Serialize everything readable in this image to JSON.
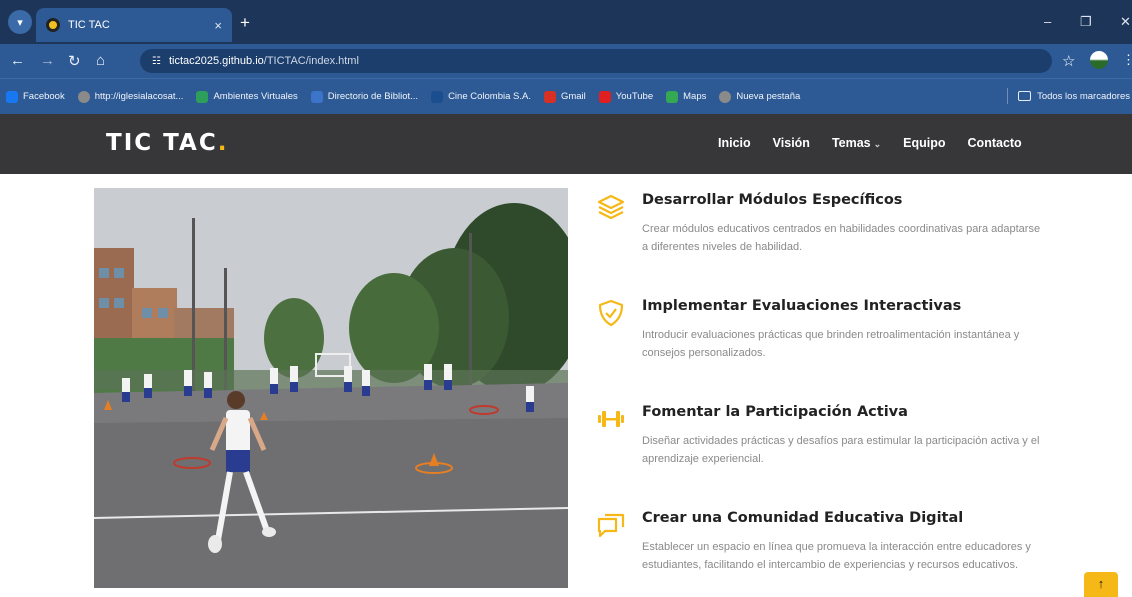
{
  "browser": {
    "tab_title": "TIC TAC",
    "new_tab_symbol": "+",
    "tab_close_symbol": "×",
    "url_host": "tictac2025.github.io",
    "url_path": "/TICTAC/index.html",
    "bookmarks": [
      {
        "label": "Facebook",
        "icon": "facebook-icon",
        "color": "#1877f2"
      },
      {
        "label": "http://iglesialacosat...",
        "icon": "globe-icon",
        "color": "#8a8a8a"
      },
      {
        "label": "Ambientes Virtuales",
        "icon": "flag-icon",
        "color": "#2e9e5b"
      },
      {
        "label": "Directorio de Bibliot...",
        "icon": "library-icon",
        "color": "#3b74c9"
      },
      {
        "label": "Cine Colombia S.A.",
        "icon": "cinema-icon",
        "color": "#1b4e8f"
      },
      {
        "label": "Gmail",
        "icon": "gmail-icon",
        "color": "#d93025"
      },
      {
        "label": "YouTube",
        "icon": "youtube-icon",
        "color": "#e02020"
      },
      {
        "label": "Maps",
        "icon": "maps-icon",
        "color": "#34a853"
      },
      {
        "label": "Nueva pestaña",
        "icon": "globe-icon",
        "color": "#8a8a8a"
      }
    ],
    "all_bookmarks_label": "Todos los marcadores"
  },
  "site": {
    "logo_text": "TIC TAC",
    "logo_dot": ".",
    "accent_color": "#f6b817",
    "nav": [
      {
        "label": "Inicio"
      },
      {
        "label": "Visión"
      },
      {
        "label": "Temas",
        "has_dropdown": true
      },
      {
        "label": "Equipo"
      },
      {
        "label": "Contacto"
      }
    ],
    "features": [
      {
        "icon": "layers-icon",
        "title": "Desarrollar Módulos Específicos",
        "description": "Crear módulos educativos centrados en habilidades coordinativas para adaptarse a diferentes niveles de habilidad."
      },
      {
        "icon": "shield-check-icon",
        "title": "Implementar Evaluaciones Interactivas",
        "description": "Introducir evaluaciones prácticas que brinden retroalimentación instantánea y consejos personalizados."
      },
      {
        "icon": "dumbbell-icon",
        "title": "Fomentar la Participación Activa",
        "description": "Diseñar actividades prácticas y desafíos para estimular la participación activa y el aprendizaje experiencial."
      },
      {
        "icon": "chat-icon",
        "title": "Crear una Comunidad Educativa Digital",
        "description": "Establecer un espacio en línea que promueva la interacción entre educadores y estudiantes, facilitando el intercambio de experiencias y recursos educativos."
      }
    ],
    "back_to_top_symbol": "↑"
  }
}
